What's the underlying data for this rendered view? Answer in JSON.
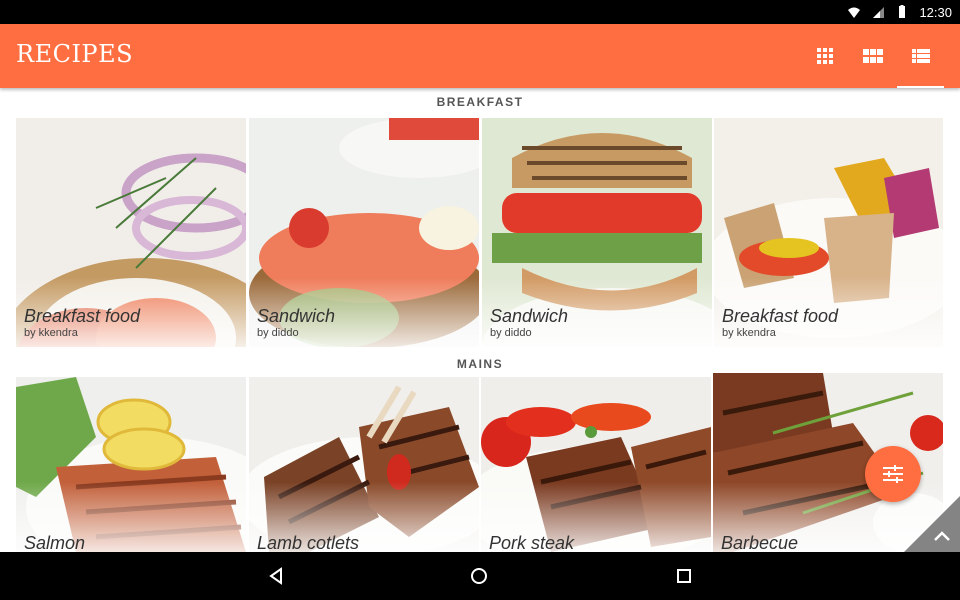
{
  "status_bar": {
    "time": "12:30",
    "icons": [
      "wifi-icon",
      "signal-icon",
      "battery-icon"
    ]
  },
  "app_bar": {
    "title": "RECIPES",
    "background": "#ff6e40",
    "view_buttons": [
      {
        "name": "small-grid-icon",
        "active": false
      },
      {
        "name": "large-grid-icon",
        "active": false
      },
      {
        "name": "list-icon",
        "active": true
      }
    ]
  },
  "sections": [
    {
      "title": "BREAKFAST",
      "items": [
        {
          "title": "Breakfast food",
          "author": "by kkendra"
        },
        {
          "title": "Sandwich",
          "author": "by diddo"
        },
        {
          "title": "Sandwich",
          "author": "by diddo"
        },
        {
          "title": "Breakfast food",
          "author": "by kkendra"
        }
      ]
    },
    {
      "title": "MAINS",
      "items": [
        {
          "title": "Salmon"
        },
        {
          "title": "Lamb cotlets"
        },
        {
          "title": "Pork steak"
        },
        {
          "title": "Barbecue"
        }
      ]
    }
  ],
  "fab": {
    "icon": "filter-icon",
    "color": "#ff6e40"
  },
  "navigation": {
    "buttons": [
      "back-icon",
      "home-icon",
      "recents-icon"
    ]
  }
}
